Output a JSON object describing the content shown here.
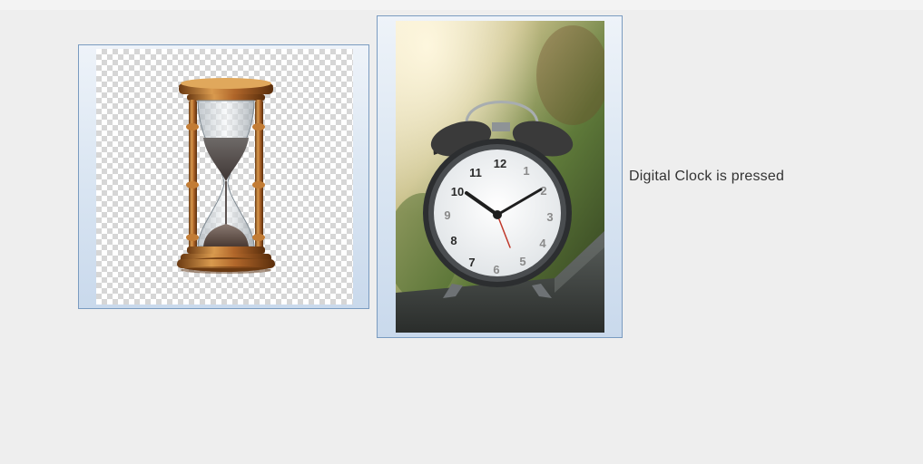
{
  "window": {
    "status_label": "Digital Clock is pressed"
  },
  "buttons": [
    {
      "id": "hourglass",
      "icon": "hourglass-icon"
    },
    {
      "id": "clock",
      "icon": "alarm-clock-icon"
    }
  ],
  "clock_face": {
    "numerals": [
      "12",
      "1",
      "2",
      "3",
      "4",
      "5",
      "6",
      "7",
      "8",
      "9",
      "10",
      "11"
    ]
  }
}
